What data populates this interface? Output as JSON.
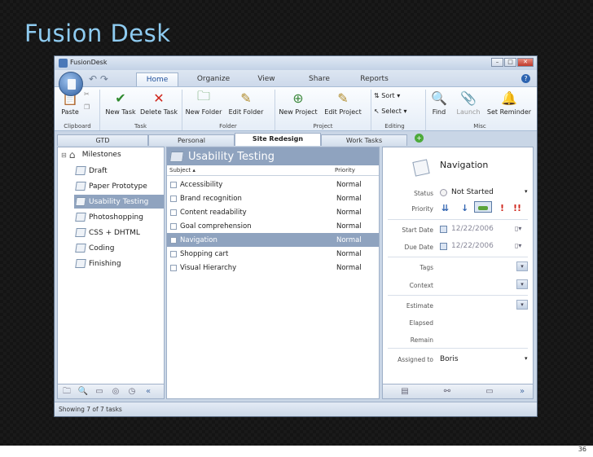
{
  "slide": {
    "title": "Fusion Desk",
    "page_number": "36"
  },
  "window": {
    "title": "FusionDesk",
    "buttons": [
      "–",
      "□",
      "✕"
    ]
  },
  "ribbon": {
    "tabs": [
      "Home",
      "Organize",
      "View",
      "Share",
      "Reports"
    ],
    "active_tab": "Home",
    "buttons": {
      "paste": "Paste",
      "new_task": "New Task",
      "delete_task": "Delete Task",
      "new_folder": "New Folder",
      "edit_folder": "Edit Folder",
      "new_project": "New Project",
      "edit_project": "Edit Project",
      "sort": "Sort",
      "select": "Select",
      "find": "Find",
      "launch": "Launch",
      "set_reminder": "Set Reminder"
    },
    "groups": [
      "Clipboard",
      "Task",
      "Folder",
      "Project",
      "Editing",
      "Misc"
    ]
  },
  "project_tabs": [
    "GTD",
    "Personal",
    "Site Redesign",
    "Work Tasks"
  ],
  "active_project_tab": "Site Redesign",
  "tree": {
    "root": "Milestones",
    "items": [
      "Draft",
      "Paper Prototype",
      "Usability Testing",
      "Photoshopping",
      "CSS + DHTML",
      "Coding",
      "Finishing"
    ],
    "selected": "Usability Testing"
  },
  "task_list": {
    "heading": "Usability Testing",
    "columns": {
      "subject": "Subject",
      "priority": "Priority"
    },
    "rows": [
      {
        "subject": "Accessibility",
        "priority": "Normal"
      },
      {
        "subject": "Brand recognition",
        "priority": "Normal"
      },
      {
        "subject": "Content readability",
        "priority": "Normal"
      },
      {
        "subject": "Goal comprehension",
        "priority": "Normal"
      },
      {
        "subject": "Navigation",
        "priority": "Normal"
      },
      {
        "subject": "Shopping cart",
        "priority": "Normal"
      },
      {
        "subject": "Visual Hierarchy",
        "priority": "Normal"
      }
    ],
    "selected": "Navigation"
  },
  "detail": {
    "title": "Navigation",
    "status_label": "Status",
    "status_value": "Not Started",
    "priority_label": "Priority",
    "start_label": "Start Date",
    "start_value": "12/22/2006",
    "due_label": "Due Date",
    "due_value": "12/22/2006",
    "tags_label": "Tags",
    "context_label": "Context",
    "estimate_label": "Estimate",
    "elapsed_label": "Elapsed",
    "remain_label": "Remain",
    "assigned_label": "Assigned to",
    "assigned_value": "Boris"
  },
  "statusbar": {
    "text": "Showing 7 of 7 tasks"
  }
}
